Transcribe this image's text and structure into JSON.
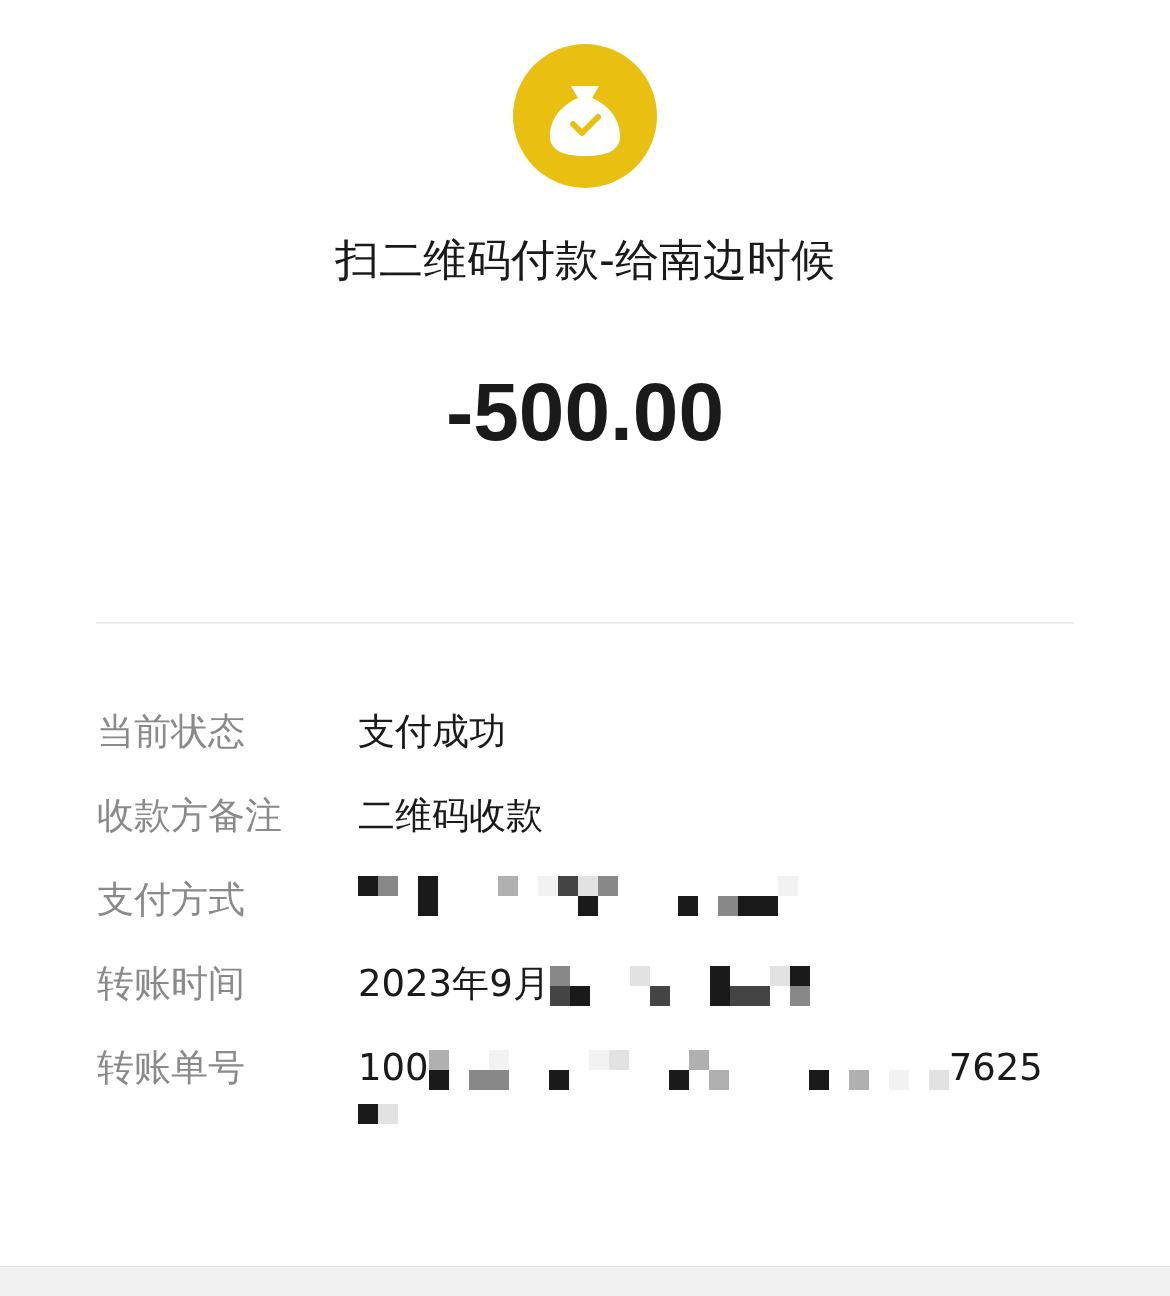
{
  "header": {
    "title": "扫二维码付款-给南边时候",
    "amount": "-500.00"
  },
  "details": [
    {
      "label": "当前状态",
      "kind": "text",
      "value": "支付成功"
    },
    {
      "label": "收款方备注",
      "kind": "text",
      "value": "二维码收款"
    },
    {
      "label": "支付方式",
      "kind": "redacted"
    },
    {
      "label": "转账时间",
      "kind": "partial",
      "value": "2023年9月"
    },
    {
      "label": "转账单号",
      "kind": "partial_wrapped",
      "value": "100",
      "value_tail": "7625"
    }
  ]
}
